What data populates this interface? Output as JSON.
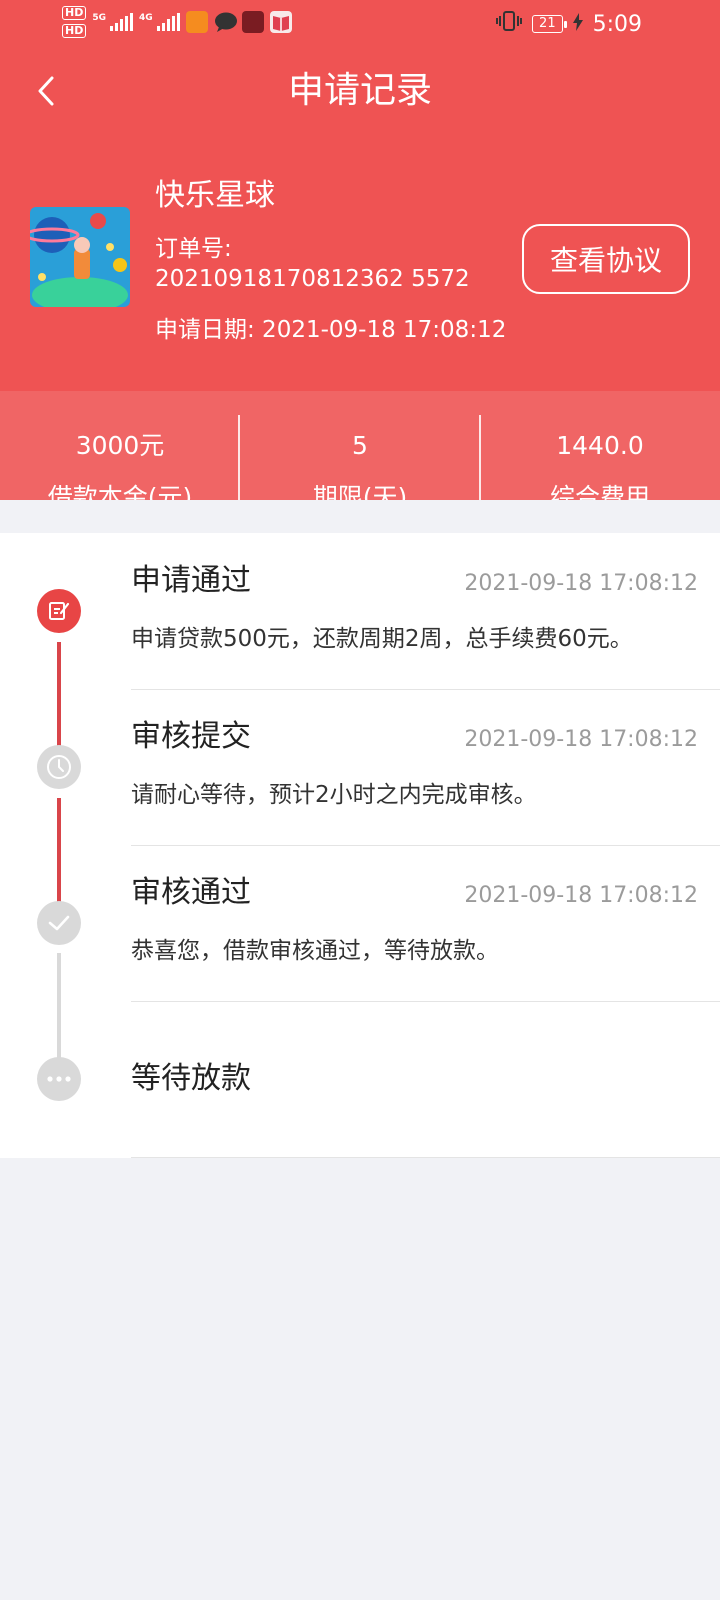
{
  "status_bar": {
    "time": "5:09",
    "battery": "21",
    "hd1": "HD",
    "hd2": "HD",
    "net1": "5G",
    "net2": "4G"
  },
  "header": {
    "title": "申请记录",
    "back_icon": "chevron-left-icon"
  },
  "order": {
    "shop_name": "快乐星球",
    "order_no_label": "订单号:",
    "order_no": "20210918170812362 5572",
    "apply_date": "申请日期: 2021-09-18 17:08:12",
    "protocol_button": "查看协议"
  },
  "stats": [
    {
      "value": "3000元",
      "label": "借款本金(元)"
    },
    {
      "value": "5",
      "label": "期限(天)"
    },
    {
      "value": "1440.0",
      "label": "综合费用"
    }
  ],
  "steps": [
    {
      "title": "申请通过",
      "time": "2021-09-18 17:08:12",
      "desc": "申请贷款500元，还款周期2周，总手续费60元。",
      "icon": "edit-icon",
      "state": "done"
    },
    {
      "title": "审核提交",
      "time": "2021-09-18 17:08:12",
      "desc": "请耐心等待，预计2小时之内完成审核。",
      "icon": "clock-icon",
      "state": "pending"
    },
    {
      "title": "审核通过",
      "time": "2021-09-18 17:08:12",
      "desc": "恭喜您，借款审核通过，等待放款。",
      "icon": "check-icon",
      "state": "pending"
    },
    {
      "title": "等待放款",
      "time": "",
      "desc": "",
      "icon": "more-icon",
      "state": "pending"
    }
  ],
  "colors": {
    "primary": "#ef5353",
    "stats_bg": "#f06565",
    "timeline_active": "#d9454a",
    "timeline_inactive": "#d9d9d9",
    "page_bg": "#f1f2f6"
  }
}
